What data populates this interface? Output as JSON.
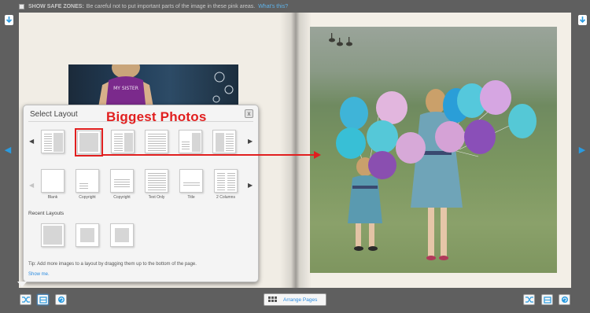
{
  "topbar": {
    "label": "SHOW SAFE ZONES:",
    "text": "Be careful not to put important parts of the image in these pink areas.",
    "link": "What's this?"
  },
  "left_photo": {
    "shirt_text": "MY SISTER"
  },
  "dialog": {
    "title": "Select Layout",
    "close_label": "x",
    "layout_labels": [
      "Blank",
      "Copyright",
      "Copyright",
      "Text Only",
      "Title",
      "2 Columns"
    ],
    "recent_title": "Recent Layouts",
    "tip": "Tip: Add more images to a layout by dragging them up to the bottom of the page.",
    "show_me": "Show me."
  },
  "annotation": {
    "callout": "Biggest Photos",
    "color": "#e11f1f"
  },
  "toolbar": {
    "arrange_label": "Arrange Pages"
  },
  "icons": [
    "download-icon",
    "shuffle-icon",
    "layout-icon",
    "refresh-icon",
    "grid-icon",
    "chevron-left-icon",
    "chevron-right-icon",
    "close-icon"
  ],
  "colors": {
    "accent": "#2a9be0",
    "background": "#5f5f5f",
    "page": "#f1ede5"
  }
}
